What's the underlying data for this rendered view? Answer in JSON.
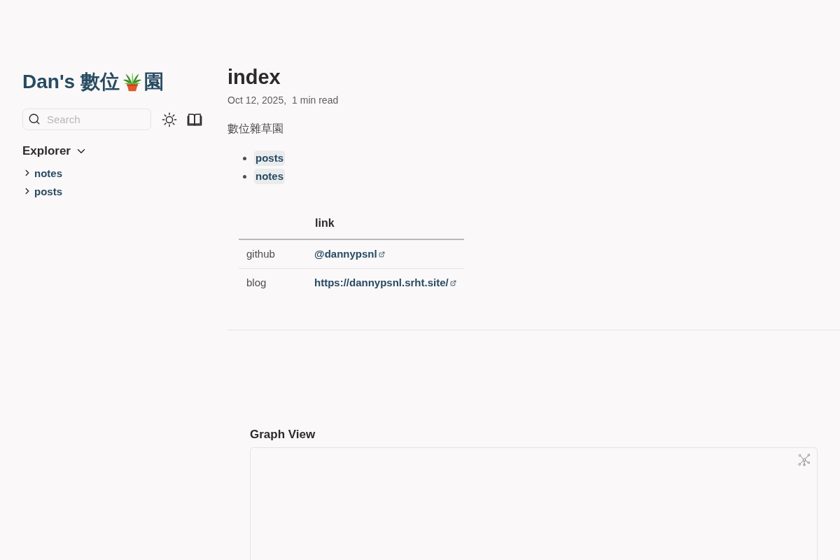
{
  "sidebar": {
    "site_title": {
      "text_before_icon": "Dan's 數位",
      "text_after_icon": "園"
    },
    "search": {
      "placeholder": "Search"
    },
    "explorer": {
      "title": "Explorer",
      "expanded": true,
      "folders": [
        {
          "label": "notes",
          "expanded": false
        },
        {
          "label": "posts",
          "expanded": false
        }
      ]
    }
  },
  "article": {
    "title": "index",
    "date": "Oct 12, 2025,",
    "reading_time": "1 min read",
    "paragraph": "數位雜草園",
    "links": [
      "posts",
      "notes"
    ],
    "table": {
      "link_column_heading": "link",
      "rows": [
        {
          "column_1": "github",
          "link": "@dannypsnl"
        },
        {
          "column_1": "blog",
          "link": "https://dannypsnl.srht.site/"
        }
      ]
    }
  },
  "graph_view": {
    "title": "Graph View"
  }
}
